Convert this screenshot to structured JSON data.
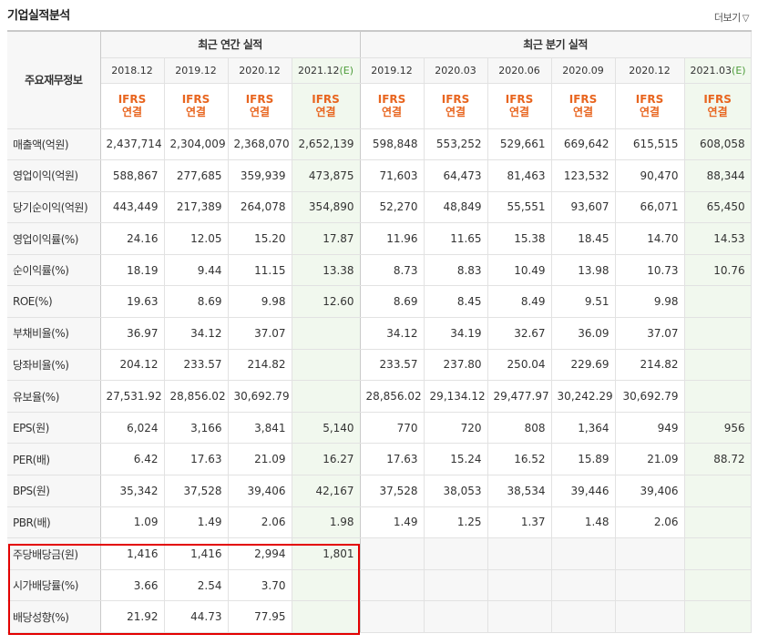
{
  "header": {
    "title": "기업실적분석",
    "more_label": "더보기",
    "more_arrow": "▽"
  },
  "table": {
    "corner_label": "주요재무정보",
    "annual_title": "최근 연간 실적",
    "quarter_title": "최근 분기 실적",
    "annual_periods": [
      {
        "label": "2018.12",
        "est": ""
      },
      {
        "label": "2019.12",
        "est": ""
      },
      {
        "label": "2020.12",
        "est": ""
      },
      {
        "label": "2021.12",
        "est": "(E)"
      }
    ],
    "quarter_periods": [
      {
        "label": "2019.12",
        "est": ""
      },
      {
        "label": "2020.03",
        "est": ""
      },
      {
        "label": "2020.06",
        "est": ""
      },
      {
        "label": "2020.09",
        "est": ""
      },
      {
        "label": "2020.12",
        "est": ""
      },
      {
        "label": "2021.03",
        "est": "(E)"
      }
    ],
    "ifrs_top": "IFRS",
    "ifrs_bottom": "연결",
    "rows": [
      {
        "label": "매출액(억원)",
        "annual": [
          "2,437,714",
          "2,304,009",
          "2,368,070",
          "2,652,139"
        ],
        "quarter": [
          "598,848",
          "553,252",
          "529,661",
          "669,642",
          "615,515",
          "608,058"
        ]
      },
      {
        "label": "영업이익(억원)",
        "annual": [
          "588,867",
          "277,685",
          "359,939",
          "473,875"
        ],
        "quarter": [
          "71,603",
          "64,473",
          "81,463",
          "123,532",
          "90,470",
          "88,344"
        ]
      },
      {
        "label": "당기순이익(억원)",
        "annual": [
          "443,449",
          "217,389",
          "264,078",
          "354,890"
        ],
        "quarter": [
          "52,270",
          "48,849",
          "55,551",
          "93,607",
          "66,071",
          "65,450"
        ]
      },
      {
        "label": "영업이익률(%)",
        "annual": [
          "24.16",
          "12.05",
          "15.20",
          "17.87"
        ],
        "quarter": [
          "11.96",
          "11.65",
          "15.38",
          "18.45",
          "14.70",
          "14.53"
        ]
      },
      {
        "label": "순이익률(%)",
        "annual": [
          "18.19",
          "9.44",
          "11.15",
          "13.38"
        ],
        "quarter": [
          "8.73",
          "8.83",
          "10.49",
          "13.98",
          "10.73",
          "10.76"
        ]
      },
      {
        "label": "ROE(%)",
        "annual": [
          "19.63",
          "8.69",
          "9.98",
          "12.60"
        ],
        "quarter": [
          "8.69",
          "8.45",
          "8.49",
          "9.51",
          "9.98",
          ""
        ]
      },
      {
        "label": "부채비율(%)",
        "annual": [
          "36.97",
          "34.12",
          "37.07",
          ""
        ],
        "quarter": [
          "34.12",
          "34.19",
          "32.67",
          "36.09",
          "37.07",
          ""
        ]
      },
      {
        "label": "당좌비율(%)",
        "annual": [
          "204.12",
          "233.57",
          "214.82",
          ""
        ],
        "quarter": [
          "233.57",
          "237.80",
          "250.04",
          "229.69",
          "214.82",
          ""
        ]
      },
      {
        "label": "유보율(%)",
        "annual": [
          "27,531.92",
          "28,856.02",
          "30,692.79",
          ""
        ],
        "quarter": [
          "28,856.02",
          "29,134.12",
          "29,477.97",
          "30,242.29",
          "30,692.79",
          ""
        ]
      },
      {
        "label": "EPS(원)",
        "annual": [
          "6,024",
          "3,166",
          "3,841",
          "5,140"
        ],
        "quarter": [
          "770",
          "720",
          "808",
          "1,364",
          "949",
          "956"
        ]
      },
      {
        "label": "PER(배)",
        "annual": [
          "6.42",
          "17.63",
          "21.09",
          "16.27"
        ],
        "quarter": [
          "17.63",
          "15.24",
          "16.52",
          "15.89",
          "21.09",
          "88.72"
        ]
      },
      {
        "label": "BPS(원)",
        "annual": [
          "35,342",
          "37,528",
          "39,406",
          "42,167"
        ],
        "quarter": [
          "37,528",
          "38,053",
          "38,534",
          "39,446",
          "39,406",
          ""
        ]
      },
      {
        "label": "PBR(배)",
        "annual": [
          "1.09",
          "1.49",
          "2.06",
          "1.98"
        ],
        "quarter": [
          "1.49",
          "1.25",
          "1.37",
          "1.48",
          "2.06",
          ""
        ]
      },
      {
        "label": "주당배당금(원)",
        "annual": [
          "1,416",
          "1,416",
          "2,994",
          "1,801"
        ],
        "quarter": [
          "",
          "",
          "",
          "",
          "",
          ""
        ]
      },
      {
        "label": "시가배당률(%)",
        "annual": [
          "3.66",
          "2.54",
          "3.70",
          ""
        ],
        "quarter": [
          "",
          "",
          "",
          "",
          "",
          ""
        ]
      },
      {
        "label": "배당성향(%)",
        "annual": [
          "21.92",
          "44.73",
          "77.95",
          ""
        ],
        "quarter": [
          "",
          "",
          "",
          "",
          "",
          ""
        ]
      }
    ]
  },
  "colors": {
    "ifrs": "#e8651f",
    "estimate_bg": "#f1f8ee",
    "estimate_tag": "#4e9d3b",
    "highlight_box": "#e30000"
  }
}
